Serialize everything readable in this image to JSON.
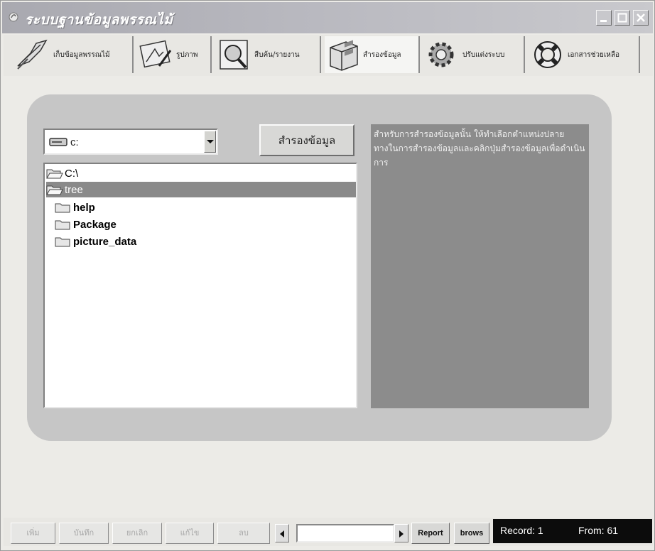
{
  "window": {
    "title": "ระบบฐานข้อมูลพรรณไม้"
  },
  "toolbar": {
    "items": [
      {
        "label": "เก็บข้อมูลพรรณไม้",
        "icon": "plant-feather-icon"
      },
      {
        "label": "รูปภาพ",
        "icon": "picture-palette-icon"
      },
      {
        "label": "สืบค้น/รายงาน",
        "icon": "magnifier-icon"
      },
      {
        "label": "สำรองข้อมูล",
        "icon": "file-cabinet-icon"
      },
      {
        "label": "ปรับแต่งระบบ",
        "icon": "gear-icon"
      },
      {
        "label": "เอกสารช่วยเหลือ",
        "icon": "lifebuoy-icon"
      }
    ],
    "active_index": 3
  },
  "backup": {
    "drive_value": "c:",
    "button_label": "สำรองข้อมูล",
    "directories": [
      {
        "name": "C:\\",
        "indent": 0,
        "state": "open"
      },
      {
        "name": "tree",
        "indent": 0,
        "state": "open-selected"
      },
      {
        "name": "help",
        "indent": 1,
        "state": "closed"
      },
      {
        "name": "Package",
        "indent": 1,
        "state": "closed"
      },
      {
        "name": "picture_data",
        "indent": 1,
        "state": "closed"
      }
    ],
    "info_text": "สำหรับการสำรองข้อมูลนั้น ให้ทำเลือกตำแหน่งปลายทางในการสำรองข้อมูลและคลิกปุ่มสำรองข้อมูลเพื่อดำเนินการ"
  },
  "status": {
    "buttons": [
      "เพิ่ม",
      "บันทึก",
      "ยกเลิก",
      "แก้ไข",
      "ลบ"
    ],
    "report_label": "Report",
    "brows_label": "brows",
    "record_label": "Record: 1",
    "from_label": "From: 61"
  }
}
